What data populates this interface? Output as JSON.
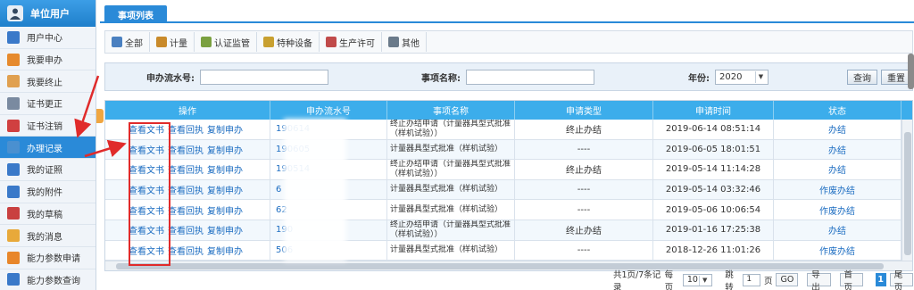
{
  "sidebar": {
    "title": "单位用户",
    "items": [
      {
        "label": "用户中心",
        "icon": "user-center-icon",
        "color": "#3a79c9"
      },
      {
        "label": "我要申办",
        "icon": "apply-pencil-icon",
        "color": "#e68a2e"
      },
      {
        "label": "我要终止",
        "icon": "stop-hand-icon",
        "color": "#e0a050"
      },
      {
        "label": "证书更正",
        "icon": "certificate-edit-icon",
        "color": "#7a8aa0"
      },
      {
        "label": "证书注销",
        "icon": "certificate-cancel-icon",
        "color": "#d04040"
      },
      {
        "label": "办理记录",
        "icon": "record-window-icon",
        "color": "#4a90d0",
        "active": true
      },
      {
        "label": "我的证照",
        "icon": "license-card-icon",
        "color": "#3a79c9"
      },
      {
        "label": "我的附件",
        "icon": "attachment-icon",
        "color": "#3a79c9"
      },
      {
        "label": "我的草稿",
        "icon": "draft-icon",
        "color": "#c94040"
      },
      {
        "label": "我的消息",
        "icon": "message-envelope-icon",
        "color": "#e8a93a"
      },
      {
        "label": "能力参数申请",
        "icon": "capability-apply-icon",
        "color": "#e8862a"
      },
      {
        "label": "能力参数查询",
        "icon": "capability-query-icon",
        "color": "#3a79c9"
      }
    ]
  },
  "tab": "事项列表",
  "toolbar": [
    {
      "label": "全部",
      "icon": "all-grid-icon",
      "color": "#4a80c0"
    },
    {
      "label": "计量",
      "icon": "tools-icon",
      "color": "#c98a2a"
    },
    {
      "label": "认证监管",
      "icon": "certification-icon",
      "color": "#7aa040"
    },
    {
      "label": "特种设备",
      "icon": "wrench-icon",
      "color": "#c8a030"
    },
    {
      "label": "生产许可",
      "icon": "production-license-icon",
      "color": "#c04a4a"
    },
    {
      "label": "其他",
      "icon": "other-icon",
      "color": "#6a7a8a"
    }
  ],
  "search": {
    "no_label": "申办流水号:",
    "name_label": "事项名称:",
    "year_label": "年份:",
    "year_value": "2020",
    "query_btn": "查询",
    "reset_btn": "重置"
  },
  "grid": {
    "headers": [
      "操作",
      "申办流水号",
      "事项名称",
      "申请类型",
      "申请时间",
      "状态"
    ],
    "actions": {
      "view": "查看文书",
      "receipt": "查看回执",
      "copy": "复制申办"
    },
    "rows": [
      {
        "no": "190614",
        "name": "终止办结申请（计量器具型式批准（样机试验））",
        "type": "终止办结",
        "time": "2019-06-14 08:51:14",
        "status": "办结"
      },
      {
        "no": "190605",
        "name": "计量器具型式批准（样机试验）",
        "type": "----",
        "time": "2019-06-05 18:01:51",
        "status": "办结"
      },
      {
        "no": "190514",
        "name": "终止办结申请（计量器具型式批准（样机试验））",
        "type": "终止办结",
        "time": "2019-05-14 11:14:28",
        "status": "办结"
      },
      {
        "no": "6",
        "name": "计量器具型式批准（样机试验）",
        "type": "----",
        "time": "2019-05-14 03:32:46",
        "status": "作废办结"
      },
      {
        "no": "62",
        "name": "计量器具型式批准（样机试验）",
        "type": "----",
        "time": "2019-05-06 10:06:54",
        "status": "作废办结"
      },
      {
        "no": "190",
        "name": "终止办结申请（计量器具型式批准（样机试验））",
        "type": "终止办结",
        "time": "2019-01-16 17:25:38",
        "status": "办结"
      },
      {
        "no": "506",
        "name": "计量器具型式批准（样机试验）",
        "type": "----",
        "time": "2018-12-26 11:01:26",
        "status": "作废办结"
      }
    ]
  },
  "pager": {
    "summary": "共1页/7条记录",
    "per_page_label": "每页",
    "per_page": "10",
    "jump_label": "跳转",
    "page_input": "1",
    "page_unit": "页",
    "go": "GO",
    "export": "导出",
    "first": "首页",
    "current": "1",
    "last": "尾页"
  }
}
